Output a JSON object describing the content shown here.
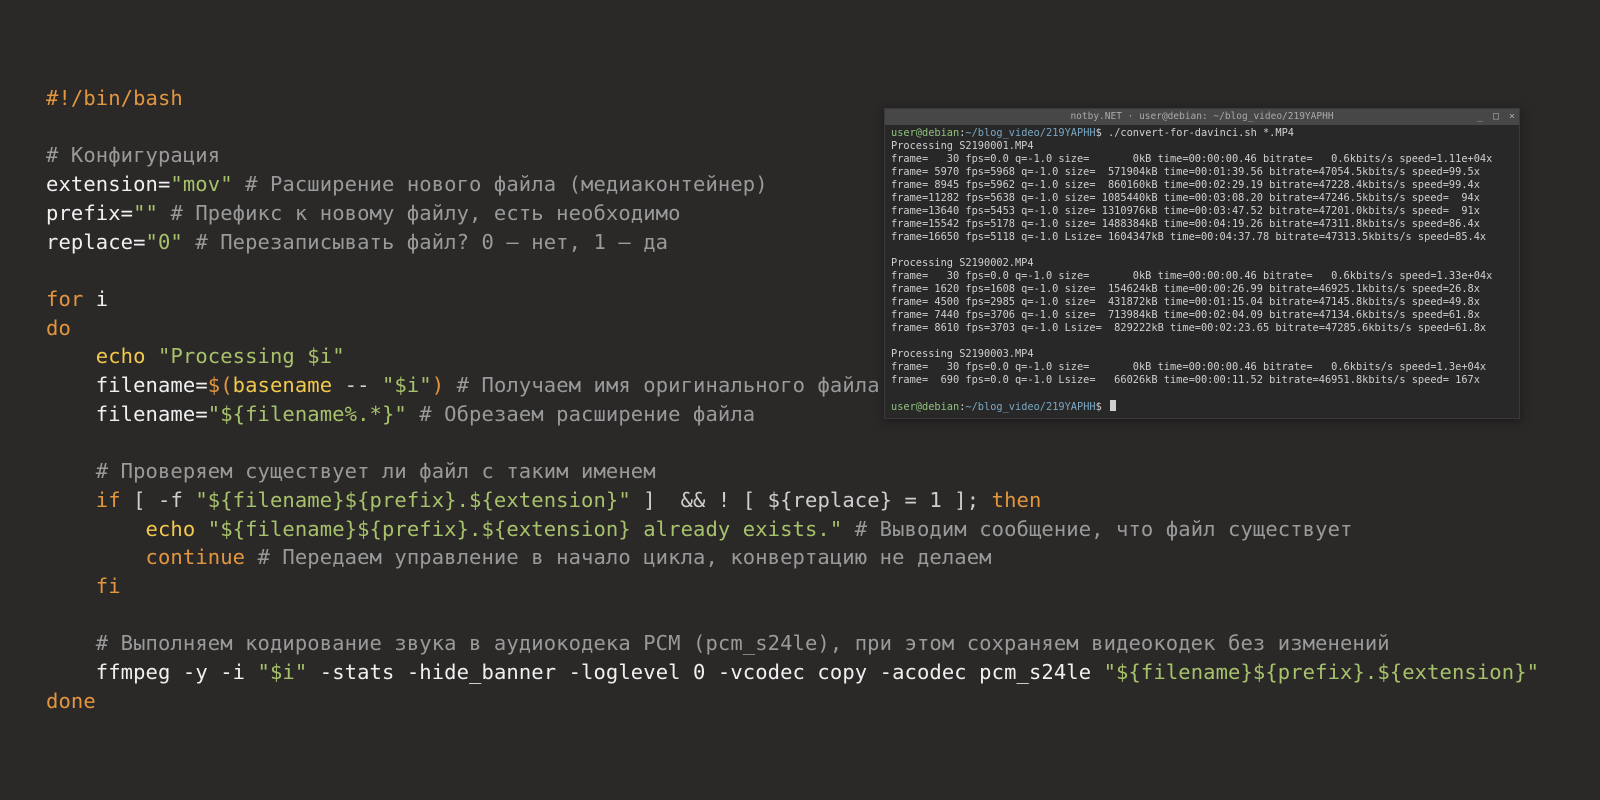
{
  "code": {
    "shebang": "#!/bin/bash",
    "blank": "",
    "c_config": "# Конфигурация",
    "l_ext_var": "extension=",
    "l_ext_val": "\"mov\"",
    "l_ext_cmt": " # Расширение нового файла (медиаконтейнер)",
    "l_pre_var": "prefix=",
    "l_pre_val": "\"\"",
    "l_pre_cmt": " # Префикс к новому файлу, есть необходимо",
    "l_rep_var": "replace=",
    "l_rep_val": "\"0\"",
    "l_rep_cmt": " # Перезаписывать файл? 0 — нет, 1 — да",
    "kw_for": "for",
    "kw_for_var": " i",
    "kw_do": "do",
    "indent": "    ",
    "cmd_echo1": "echo",
    "s_proc": " \"Processing $i\"",
    "fn_assign": "filename=",
    "doll_open": "$(",
    "cmd_basename": "basename",
    "bn_args": " -- ",
    "s_dqi": "\"$i\"",
    "doll_close": ")",
    "cmt_getname": " # Получаем имя оригинального файла",
    "s_fnstrip": "\"${filename%.*}\"",
    "cmt_strip": " # Обрезаем расширение файла",
    "cmt_check": "# Проверяем существует ли файл с таким именем",
    "kw_if": "if",
    "brak_open": " [ -f ",
    "s_target": "\"${filename}${prefix}.${extension}\"",
    "brak_close": " ]  && ! [ ${replace} = 1 ]; ",
    "kw_then": "then",
    "indent2": "        ",
    "cmd_echo2": "echo",
    "s_exists": " \"${filename}${prefix}.${extension} already exists.\"",
    "cmt_exists": " # Выводим сообщение, что файл существует",
    "kw_continue": "continue",
    "cmt_continue": " # Передаем управление в начало цикла, конвертацию не делаем",
    "kw_fi": "fi",
    "cmt_encode": "# Выполняем кодирование звука в аудиокодека PCM (pcm_s24le), при этом сохраняем видеокодек без изменений",
    "cmd_ffmpeg": "ffmpeg -y -i ",
    "s_i2": "\"$i\"",
    "ff_args": " -stats -hide_banner -loglevel 0 -vcodec copy -acodec pcm_s24le ",
    "s_outfile": "\"${filename}${prefix}.${extension}\"",
    "kw_done": "done"
  },
  "terminal": {
    "title": "notby.NET · user@debian: ~/blog_video/219YAPHH",
    "btn_min": "_",
    "btn_max": "□",
    "btn_close": "×",
    "p_userhost": "user@debian",
    "p_colon": ":",
    "p_path": "~/blog_video/219YAPHH",
    "p_dollar": "$ ",
    "cmd1": "./convert-for-davinci.sh *.MP4",
    "lines": [
      "Processing S2190001.MP4",
      "frame=   30 fps=0.0 q=-1.0 size=       0kB time=00:00:00.46 bitrate=   0.6kbits/s speed=1.11e+04x",
      "frame= 5970 fps=5968 q=-1.0 size=  571904kB time=00:01:39.56 bitrate=47054.5kbits/s speed=99.5x",
      "frame= 8945 fps=5962 q=-1.0 size=  860160kB time=00:02:29.19 bitrate=47228.4kbits/s speed=99.4x",
      "frame=11282 fps=5638 q=-1.0 size= 1085440kB time=00:03:08.20 bitrate=47246.5kbits/s speed=  94x",
      "frame=13640 fps=5453 q=-1.0 size= 1310976kB time=00:03:47.52 bitrate=47201.0kbits/s speed=  91x",
      "frame=15542 fps=5178 q=-1.0 size= 1488384kB time=00:04:19.26 bitrate=47311.8kbits/s speed=86.4x",
      "frame=16650 fps=5118 q=-1.0 Lsize= 1604347kB time=00:04:37.78 bitrate=47313.5kbits/s speed=85.4x",
      "",
      "Processing S2190002.MP4",
      "frame=   30 fps=0.0 q=-1.0 size=       0kB time=00:00:00.46 bitrate=   0.6kbits/s speed=1.33e+04x",
      "frame= 1620 fps=1608 q=-1.0 size=  154624kB time=00:00:26.99 bitrate=46925.1kbits/s speed=26.8x",
      "frame= 4500 fps=2985 q=-1.0 size=  431872kB time=00:01:15.04 bitrate=47145.8kbits/s speed=49.8x",
      "frame= 7440 fps=3706 q=-1.0 size=  713984kB time=00:02:04.09 bitrate=47134.6kbits/s speed=61.8x",
      "frame= 8610 fps=3703 q=-1.0 Lsize=  829222kB time=00:02:23.65 bitrate=47285.6kbits/s speed=61.8x",
      "",
      "Processing S2190003.MP4",
      "frame=   30 fps=0.0 q=-1.0 size=       0kB time=00:00:00.46 bitrate=   0.6kbits/s speed=1.3e+04x",
      "frame=  690 fps=0.0 q=-1.0 Lsize=   66026kB time=00:00:11.52 bitrate=46951.8kbits/s speed= 167x",
      ""
    ]
  }
}
